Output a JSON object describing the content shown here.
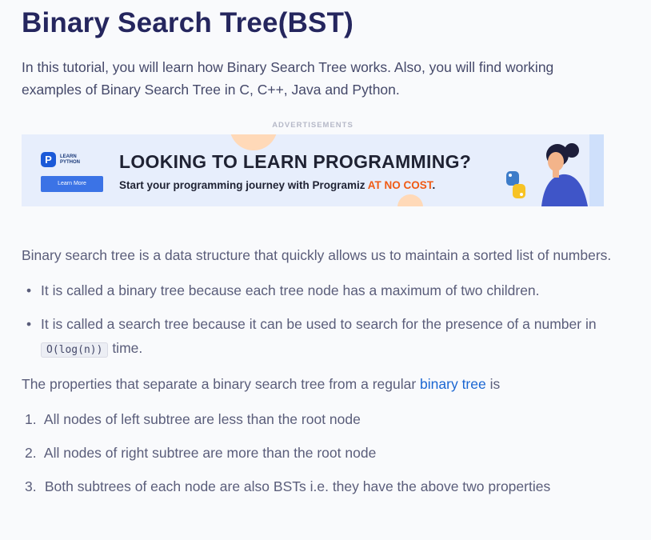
{
  "article": {
    "title": "Binary Search Tree(BST)",
    "intro": "In this tutorial, you will learn how Binary Search Tree works. Also, you will find working examples of Binary Search Tree in C, C++, Java and Python."
  },
  "ad": {
    "caption": "ADVERTISEMENTS",
    "logo_line1": "LEARN",
    "logo_line2": "PYTHON",
    "button_label": "Learn More",
    "headline": "LOOKING TO LEARN PROGRAMMING?",
    "sub_prefix": "Start your programming journey with Programiz ",
    "sub_highlight": "AT NO COST",
    "sub_suffix": "."
  },
  "definition": "Binary search tree is a data structure that quickly allows us to maintain a sorted list of numbers.",
  "bullets": {
    "item1": "It is called a binary tree because each tree node has a maximum of two children.",
    "item2_text": "It is called a search tree because it can be used to search for the presence of a number in",
    "item2_code": "O(log(n))",
    "item2_suffix": " time."
  },
  "properties": {
    "prefix": "The properties that separate a binary search tree from a regular ",
    "link": "binary tree",
    "suffix": " is"
  },
  "rules": [
    {
      "num": "1.",
      "text": "All nodes of left subtree are less than the root node"
    },
    {
      "num": "2.",
      "text": "All nodes of right subtree are more than the root node"
    },
    {
      "num": "3.",
      "text": "Both subtrees of each node are also BSTs i.e. they have the above two properties"
    }
  ],
  "colors": {
    "title": "#25265e",
    "link": "#1a66d2",
    "ad_highlight": "#f05a14",
    "ad_button": "#3b73e6"
  }
}
